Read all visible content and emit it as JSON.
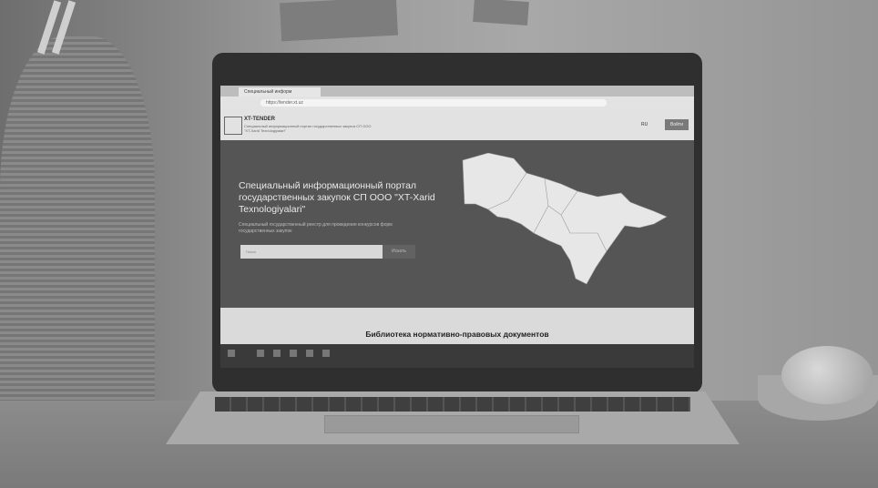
{
  "browser": {
    "tab_title": "Специальный информ",
    "url": "https://tender.xt.uz"
  },
  "site": {
    "logo_text": "XT-TENDER",
    "logo_subtitle": "Специальный информационный портал государственных закупок СП ООО \"XT-Xarid Texnologiyalari\"",
    "lang": "RU",
    "login_label": "Войти"
  },
  "hero": {
    "title": "Специальный информационный портал государственных закупок СП ООО \"XT-Xarid Texnologiyalari\"",
    "subtitle": "Специальный государственный реестр для проведения конкурсов форм государственных закупок",
    "search_placeholder": "Поиск",
    "search_button": "Искать"
  },
  "library": {
    "title": "Библиотека нормативно-правовых документов"
  },
  "colors": {
    "screen_bg": "#555555",
    "header_bg": "#e2e2e2",
    "map_fill": "#e7e7e7"
  }
}
